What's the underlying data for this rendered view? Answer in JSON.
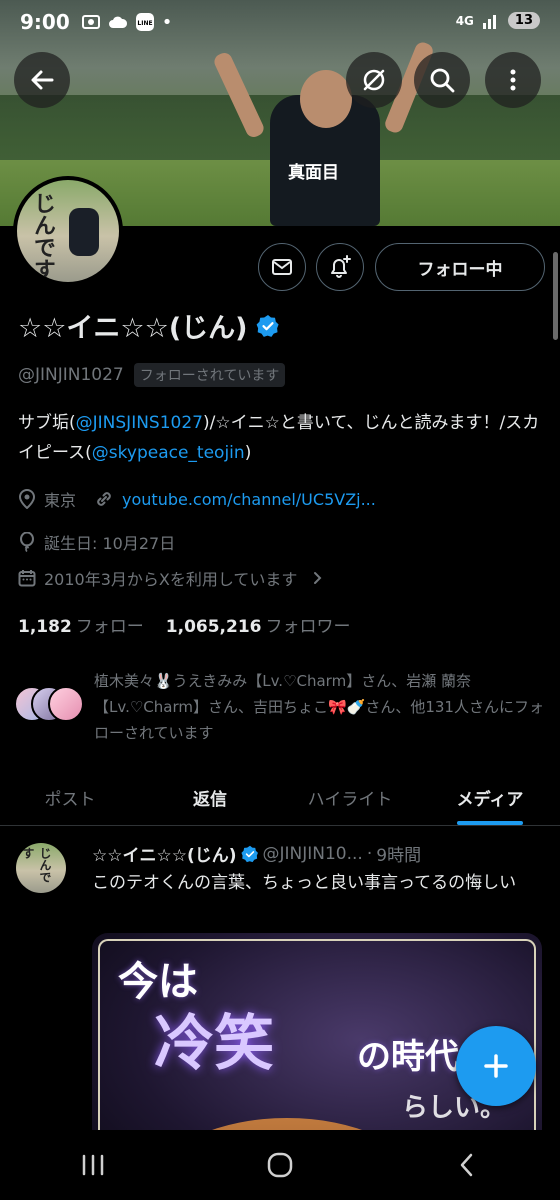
{
  "status_bar": {
    "time": "9:00",
    "network": "4G",
    "battery": "13"
  },
  "banner": {
    "shirt_text": "真面目"
  },
  "profile": {
    "display_name": "☆☆イニ☆☆(じん)",
    "handle": "@JINJIN1027",
    "follows_you": "フォローされています",
    "follow_button": "フォロー中",
    "bio": {
      "p1": "サブ垢(",
      "mention1": "@JINSJINS1027",
      "p2": ")/☆イニ☆と書いて、じんと読みます！/スカイピース(",
      "mention2": "@skypeace_teojin",
      "p3": ")"
    },
    "location": "東京",
    "url": "youtube.com/channel/UC5VZj...",
    "birthday": "誕生日: 10月27日",
    "joined": "2010年3月からXを利用しています",
    "following_count": "1,182",
    "following_label": "フォロー",
    "followers_count": "1,065,216",
    "followers_label": "フォロワー",
    "followed_by": "植木美々🐰うえきみみ【Lv.♡Charm】さん、岩瀬 蘭奈【Lv.♡Charm】さん、吉田ちょこ🎀🍼さん、他131人さんにフォローされています"
  },
  "tabs": [
    {
      "label": "ポスト"
    },
    {
      "label": "返信"
    },
    {
      "label": "ハイライト"
    },
    {
      "label": "メディア"
    }
  ],
  "post": {
    "name": "☆☆イニ☆☆(じん)",
    "handle": "@JINJIN10...",
    "separator": "·",
    "time": "9時間",
    "text": "このテオくんの言葉、ちょっと良い事言ってるの悔しい",
    "media": {
      "line1": "今は",
      "line2": "冷笑",
      "line3": "の時代",
      "line4": "らしい。"
    }
  },
  "colors": {
    "accent": "#1d9bf0",
    "background": "#000000",
    "text": "#e7e9ea",
    "muted": "#71767b"
  }
}
